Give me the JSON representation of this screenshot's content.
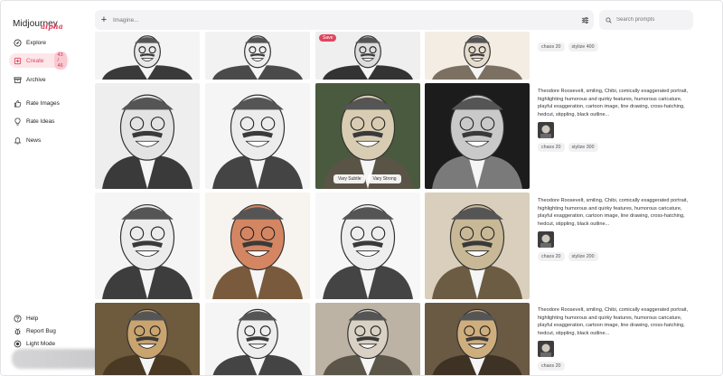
{
  "app": {
    "logo": "Midjourney",
    "logo_badge": "alpha"
  },
  "sidebar": {
    "items": [
      {
        "label": "Explore",
        "icon": "compass-icon"
      },
      {
        "label": "Create",
        "icon": "create-icon",
        "count": "43 / 46",
        "active": true
      },
      {
        "label": "Archive",
        "icon": "archive-icon"
      },
      {
        "label": "Rate Images",
        "icon": "thumbs-up-icon"
      },
      {
        "label": "Rate Ideas",
        "icon": "lightbulb-icon"
      },
      {
        "label": "News",
        "icon": "bell-icon"
      }
    ],
    "footer": [
      {
        "label": "Help",
        "icon": "help-icon"
      },
      {
        "label": "Report Bug",
        "icon": "bug-icon"
      },
      {
        "label": "Light Mode",
        "icon": "sun-icon"
      }
    ]
  },
  "topbar": {
    "plus": "+",
    "imagine_placeholder": "Imagine...",
    "search_placeholder": "Search prompts"
  },
  "gallery": {
    "save_label": "Save",
    "vary_subtle_label": "Vary Subtle",
    "vary_strong_label": "Vary Strong"
  },
  "rows": [
    {
      "prompt": "",
      "tags": [
        "chaos 20",
        "stylize 400"
      ]
    },
    {
      "prompt": "Theodore Roosevelt, smiling, Chibi, comically exaggerated portrait, highlighting humorous and quirky features, humorous caricature, playful exaggeration, cartoon image, line drawing, cross-hatching, hedcut, stippling, black outline...",
      "tags": [
        "chaos 20",
        "stylize 300"
      ]
    },
    {
      "prompt": "Theodore Roosevelt, smiling, Chibi, comically exaggerated portrait, highlighting humorous and quirky features, humorous caricature, playful exaggeration, cartoon image, line drawing, cross-hatching, hedcut, stippling, black outline...",
      "tags": [
        "chaos 20",
        "stylize 200"
      ]
    },
    {
      "prompt": "Theodore Roosevelt, smiling, Chibi, comically exaggerated portrait, highlighting humorous and quirky features, humorous caricature, playful exaggeration, cartoon image, line drawing, cross-hatching, hedcut, stippling, black outline...",
      "tags": [
        "chaos 20"
      ]
    }
  ],
  "colors": {
    "accent": "#e0455e",
    "accent_bg": "#fde6e9",
    "field_bg": "#f3f3f5"
  }
}
